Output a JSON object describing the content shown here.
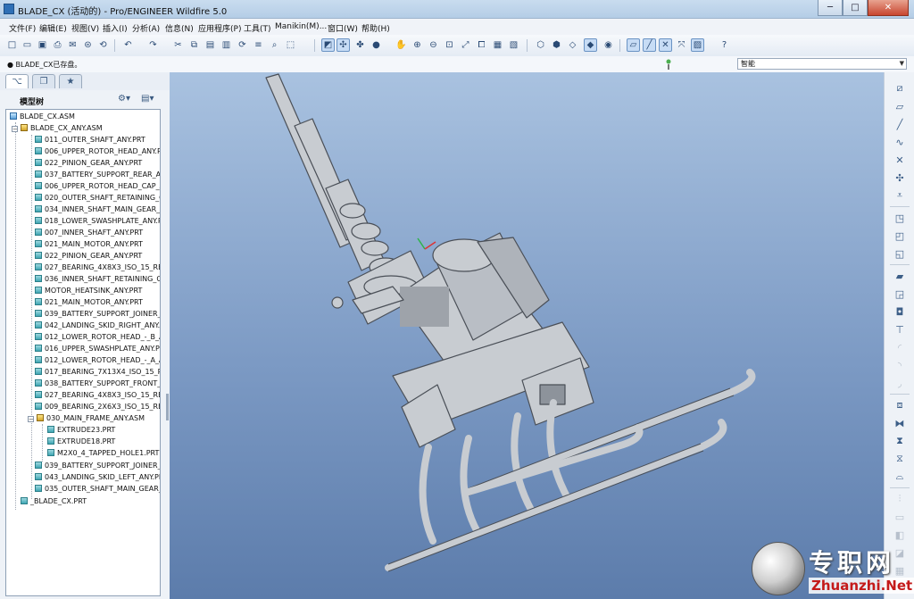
{
  "window": {
    "title": "BLADE_CX (活动的) - Pro/ENGINEER Wildfire 5.0",
    "minimize": "─",
    "maximize": "□",
    "close": "✕"
  },
  "menu": [
    "文件(F)",
    "编辑(E)",
    "视图(V)",
    "插入(I)",
    "分析(A)",
    "信息(N)",
    "应用程序(P)",
    "工具(T)",
    "Manikin(M)...",
    "窗口(W)",
    "帮助(H)"
  ],
  "message": "● BLADE_CX已存盘。",
  "smart_filter": "智能",
  "model_tree": {
    "title": "模型树",
    "root": "BLADE_CX.ASM",
    "subasm": "BLADE_CX_ANY.ASM",
    "items": [
      "011_OUTER_SHAFT_ANY.PRT",
      "006_UPPER_ROTOR_HEAD_ANY.PRT",
      "022_PINION_GEAR_ANY.PRT",
      "037_BATTERY_SUPPORT_REAR_ANY",
      "006_UPPER_ROTOR_HEAD_CAP_ANY",
      "020_OUTER_SHAFT_RETAINING_CO",
      "034_INNER_SHAFT_MAIN_GEAR_AN",
      "018_LOWER_SWASHPLATE_ANY.PRT",
      "007_INNER_SHAFT_ANY.PRT",
      "021_MAIN_MOTOR_ANY.PRT",
      "022_PINION_GEAR_ANY.PRT",
      "027_BEARING_4X8X3_ISO_15_RBE",
      "036_INNER_SHAFT_RETAINING_CO",
      "MOTOR_HEATSINK_ANY.PRT",
      "021_MAIN_MOTOR_ANY.PRT",
      "039_BATTERY_SUPPORT_JOINER_A",
      "042_LANDING_SKID_RIGHT_ANY.PR",
      "012_LOWER_ROTOR_HEAD_-_B_ANY",
      "016_UPPER_SWASHPLATE_ANY.PRT",
      "012_LOWER_ROTOR_HEAD_-_A_ANY",
      "017_BEARING_7X13X4_ISO_15_RBE",
      "038_BATTERY_SUPPORT_FRONT_AN",
      "027_BEARING_4X8X3_ISO_15_RBE",
      "009_BEARING_2X6X3_ISO_15_RBE"
    ],
    "frame_asm": "030_MAIN_FRAME_ANY.ASM",
    "frame_children": [
      "EXTRUDE23.PRT",
      "EXTRUDE18.PRT",
      "M2X0_4_TAPPED_HOLE1.PRT"
    ],
    "after_items": [
      "039_BATTERY_SUPPORT_JOINER_A",
      "043_LANDING_SKID_LEFT_ANY.PRT",
      "035_OUTER_SHAFT_MAIN_GEAR_AN"
    ],
    "last": "_BLADE_CX.PRT"
  },
  "watermark": {
    "cn": "专职网",
    "en": "Zhuanzhi.Net"
  },
  "colors": {
    "viewport_top": "#a9c2e0",
    "viewport_bottom": "#5c7cab",
    "model": "#c8ccd1"
  }
}
